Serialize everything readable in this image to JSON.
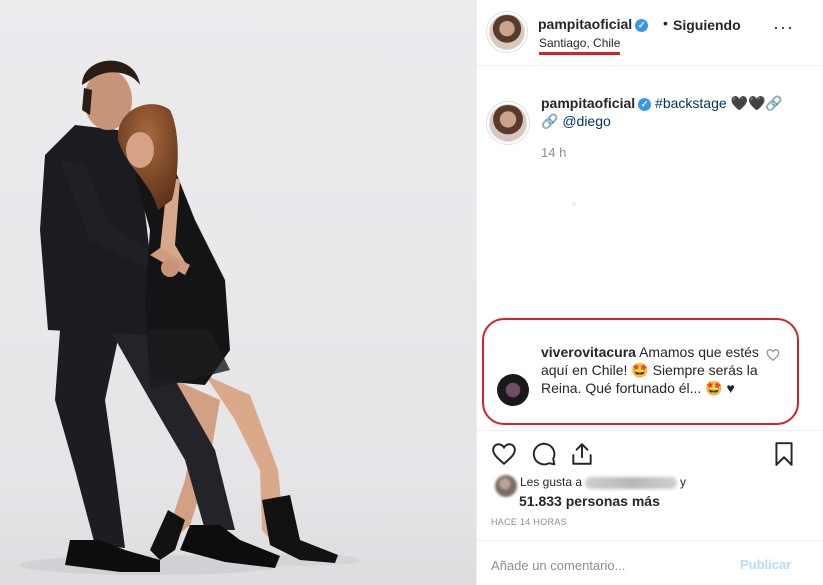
{
  "post": {
    "username": "pampitaoficial",
    "verified_glyph": "✓",
    "follow_status": "Siguiendo",
    "separator": "•",
    "location": "Santiago, Chile",
    "more_glyph": "···"
  },
  "caption": {
    "username": "pampitaoficial",
    "hashtag": "#backstage",
    "emojis": "🖤🖤🔗",
    "link_glyph": "🔗",
    "mention": "@diego",
    "time": "14 h"
  },
  "comment": {
    "username": "viverovitacura",
    "text_1": "Amamos que estés aquí en Chile! 🤩 Siempre serás la Reina. Qué fortunado él... 🤩",
    "heart_glyph": "♥"
  },
  "likes": {
    "prefix": "Les gusta a",
    "suffix": "y",
    "count": "51.833",
    "count_suffix": "personas más"
  },
  "posted_ago": "HACE 14 HORAS",
  "comment_input": {
    "placeholder": "Añade un comentario...",
    "publish_label": "Publicar"
  },
  "icons": [
    "heart-icon",
    "comment-icon",
    "share-icon",
    "bookmark-icon",
    "more-options-icon",
    "verified-badge-icon"
  ],
  "colors": {
    "verified": "#3897f0",
    "highlight_red": "#d2232a",
    "link": "#003569",
    "muted": "#8e8e8e",
    "publish_disabled": "#b3dbff"
  }
}
